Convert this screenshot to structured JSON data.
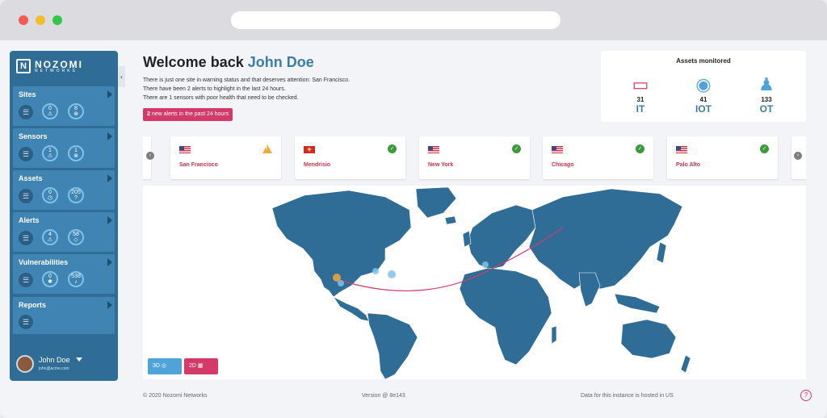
{
  "sidebar": {
    "brand": {
      "line1": "NOZOMI",
      "line2": "NETWORKS"
    },
    "sections": [
      {
        "title": "Sites",
        "stats": [
          {
            "value": "0",
            "icon": "warning"
          },
          {
            "value": "8",
            "icon": "x"
          }
        ]
      },
      {
        "title": "Sensors",
        "stats": [
          {
            "value": "1",
            "icon": "warning"
          },
          {
            "value": "1",
            "icon": "x"
          }
        ]
      },
      {
        "title": "Assets",
        "stats": [
          {
            "value": "0",
            "icon": "clock"
          },
          {
            "value": "205",
            "icon": "question"
          }
        ]
      },
      {
        "title": "Alerts",
        "stats": [
          {
            "value": "4",
            "icon": "warning"
          },
          {
            "value": "58",
            "icon": "diamond-warning"
          }
        ]
      },
      {
        "title": "Vulnerabilities",
        "stats": [
          {
            "value": "0",
            "icon": "bug"
          },
          {
            "value": "538",
            "icon": "bell"
          }
        ]
      },
      {
        "title": "Reports",
        "stats": []
      }
    ],
    "user": {
      "name": "John Doe",
      "email": "john@acme.com"
    }
  },
  "header": {
    "welcome_prefix": "Welcome back",
    "user_name": "John Doe",
    "messages": [
      "There is just one site in warning status and that deserves attention: San Francisco.",
      "There have been 2 alerts to highlight in the last 24 hours.",
      "There are 1 sensors with poor health that need to be checked."
    ],
    "alert_button": {
      "count": "2",
      "text": "new alerts in the past 24 hours"
    }
  },
  "assets": {
    "title": "Assets monitored",
    "items": [
      {
        "count": "31",
        "label": "IT",
        "icon": "monitor-icon",
        "color": "#d33a6a"
      },
      {
        "count": "41",
        "label": "IOT",
        "icon": "webcam-icon",
        "color": "#4ea3d8"
      },
      {
        "count": "133",
        "label": "OT",
        "icon": "robot-arm-icon",
        "color": "#4ea3d8"
      }
    ]
  },
  "sites": [
    {
      "name": "San Francisco",
      "flag": "us",
      "status": "warning"
    },
    {
      "name": "Mendrisio",
      "flag": "ch",
      "status": "ok"
    },
    {
      "name": "New York",
      "flag": "us",
      "status": "ok"
    },
    {
      "name": "Chicago",
      "flag": "us",
      "status": "ok"
    },
    {
      "name": "Palo Alto",
      "flag": "us",
      "status": "ok"
    }
  ],
  "map": {
    "view_3d": "3D",
    "view_2d": "2D"
  },
  "footer": {
    "copyright": "© 2020 Nozomi Networks",
    "version": "Version @ 8e143",
    "hosting": "Data for this instance is hosted in US"
  },
  "colors": {
    "primary": "#2f6d96",
    "accent": "#d33a6a",
    "highlight": "#3a7da8"
  }
}
